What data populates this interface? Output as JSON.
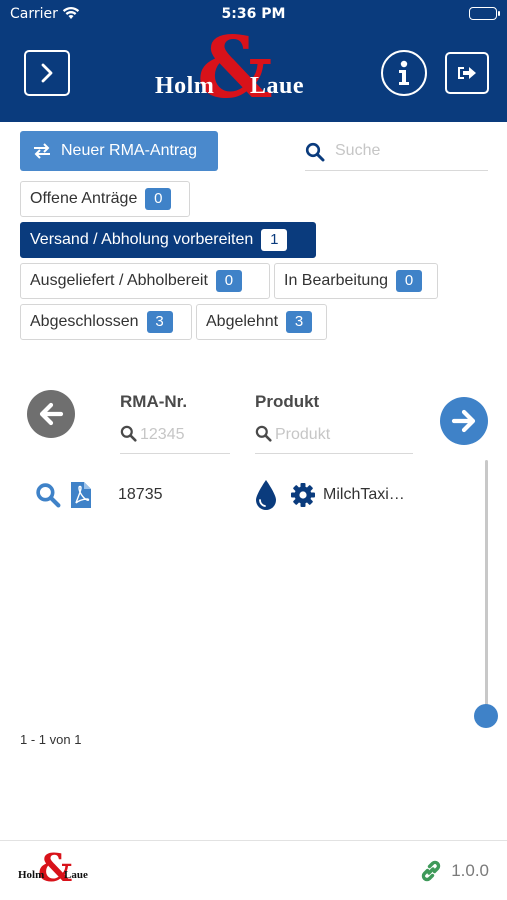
{
  "status_bar": {
    "carrier": "Carrier",
    "time": "5:36 PM"
  },
  "header": {
    "brand_left": "Holm",
    "brand_right": "Laue",
    "brand_amp": "&",
    "menu_icon": "chevron-right-icon",
    "info_icon": "info-icon",
    "logout_icon": "sign-out-icon",
    "color": "#0a3b7d",
    "logo_red": "#d8121a"
  },
  "toolbar": {
    "new_button": "Neuer RMA-Antrag",
    "new_icon": "exchange-arrows-icon",
    "search_placeholder": "Suche"
  },
  "filters": [
    {
      "label": "Offene Anträge",
      "count": "0",
      "active": false
    },
    {
      "label": "Versand / Abholung vorbereiten",
      "count": "1",
      "active": true
    },
    {
      "label": "Ausgeliefert / Abholbereit",
      "count": "0",
      "active": false
    },
    {
      "label": "In Bearbeitung",
      "count": "0",
      "active": false
    },
    {
      "label": "Abgeschlossen",
      "count": "3",
      "active": false
    },
    {
      "label": "Abgelehnt",
      "count": "3",
      "active": false
    }
  ],
  "table": {
    "columns": [
      {
        "header": "RMA-Nr.",
        "filter_placeholder": "12345"
      },
      {
        "header": "Produkt",
        "filter_placeholder": "Produkt"
      }
    ],
    "rows": [
      {
        "rma_no": "18735",
        "product": "MilchTaxi…",
        "icons": [
          "search-icon",
          "file-pdf-icon",
          "drop-icon",
          "gear-icon"
        ]
      }
    ],
    "pager": "1 - 1 von 1"
  },
  "footer": {
    "version": "1.0.0",
    "link_icon": "link-icon"
  },
  "colors": {
    "accent": "#3f82c8",
    "button": "#4a89cc",
    "link_green": "#3f9a5a"
  }
}
